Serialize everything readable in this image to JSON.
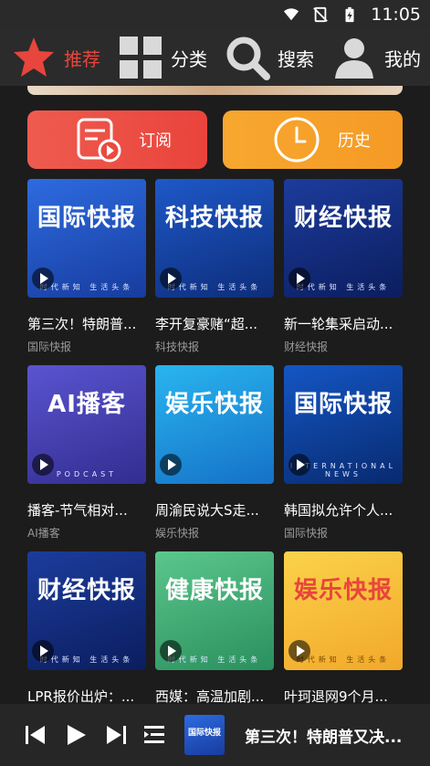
{
  "status_bar": {
    "time": "11:05"
  },
  "nav": [
    {
      "label": "推荐",
      "icon": "star-icon",
      "active": true
    },
    {
      "label": "分类",
      "icon": "category-grid-icon",
      "active": false
    },
    {
      "label": "搜索",
      "icon": "search-icon",
      "active": false
    },
    {
      "label": "我的",
      "icon": "user-icon",
      "active": false
    }
  ],
  "quick": {
    "subscribe_label": "订阅",
    "history_label": "历史"
  },
  "cards": [
    {
      "title": "第三次！特朗普...",
      "tag": "国际快报",
      "thumb_text": "国际快报",
      "thumb_sub": "时代新知 生活头条",
      "bg": "#1e4bbd"
    },
    {
      "title": "李开复豪赌“超...",
      "tag": "科技快报",
      "thumb_text": "科技快报",
      "thumb_sub": "时代新知 生活头条",
      "bg": "#123a97"
    },
    {
      "title": "新一轮集采启动...",
      "tag": "财经快报",
      "thumb_text": "财经快报",
      "thumb_sub": "时代新知 生活头条",
      "bg": "#10297a"
    },
    {
      "title": "播客-节气相对...",
      "tag": "AI播客",
      "thumb_text": "AI播客",
      "thumb_sub": "PODCAST",
      "bg": "#4b44b8"
    },
    {
      "title": "周渝民说大S走...",
      "tag": "娱乐快报",
      "thumb_text": "娱乐快报",
      "thumb_sub": "",
      "bg": "#1b8fd6"
    },
    {
      "title": "韩国拟允许个人...",
      "tag": "国际快报",
      "thumb_text": "国际快报",
      "thumb_sub": "INTERNATIONAL NEWS",
      "bg": "#0d3f9a"
    },
    {
      "title": "LPR报价出炉：...",
      "tag": "",
      "thumb_text": "财经快报",
      "thumb_sub": "时代新知 生活头条",
      "bg": "#10297a"
    },
    {
      "title": "西媒：高温加剧...",
      "tag": "",
      "thumb_text": "健康快报",
      "thumb_sub": "时代新知 生活头条",
      "bg": "#2ea36b"
    },
    {
      "title": "叶珂退网9个月...",
      "tag": "",
      "thumb_text": "娱乐快报",
      "thumb_sub": "时代新知 生活头条",
      "bg": "#f5c43a"
    }
  ],
  "player": {
    "now_playing": "第三次！特朗普又决...",
    "thumb_text": "国际快报"
  },
  "colors": {
    "accent": "#e8453c",
    "background": "#1c1c1c"
  }
}
